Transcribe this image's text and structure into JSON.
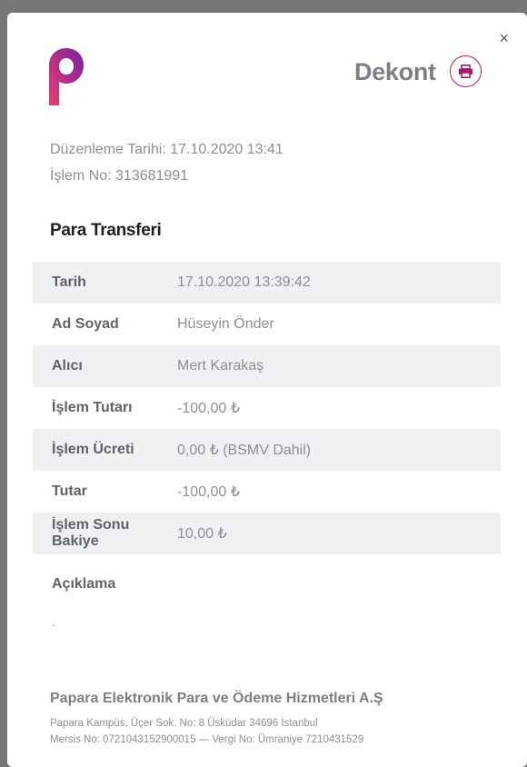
{
  "header": {
    "close_label": "×",
    "title": "Dekont",
    "print_icon": "printer-icon",
    "brand_colors": [
      "#e83e6b",
      "#7a1fa8"
    ]
  },
  "meta": {
    "duzenleme": "Düzenleme Tarihi: 17.10.2020 13:41",
    "islem_no": "İşlem No: 313681991"
  },
  "section_title": "Para Transferi",
  "rows": [
    {
      "label": "Tarih",
      "value": "17.10.2020 13:39:42"
    },
    {
      "label": "Ad Soyad",
      "value": "Hüseyin Önder"
    },
    {
      "label": "Alıcı",
      "value": "Mert Karakaş"
    },
    {
      "label": "İşlem Tutarı",
      "value": "-100,00 ₺"
    },
    {
      "label": "İşlem Ücreti",
      "value": "0,00 ₺ (BSMV Dahil)"
    },
    {
      "label": "Tutar",
      "value": "-100,00 ₺"
    },
    {
      "label": "İşlem Sonu Bakiye",
      "value": "10,00 ₺"
    }
  ],
  "aciklama": {
    "label": "Açıklama",
    "value": "."
  },
  "footer": {
    "company": "Papara Elektronik Para ve Ödeme Hizmetleri A.Ş",
    "address": "Papara Kampüs, Üçer Sok. No: 8 Üsküdar 34696 İstanbul",
    "registry": "Mersis No: 0721043152900015 — Vergi No: Ümraniye 7210431529"
  }
}
